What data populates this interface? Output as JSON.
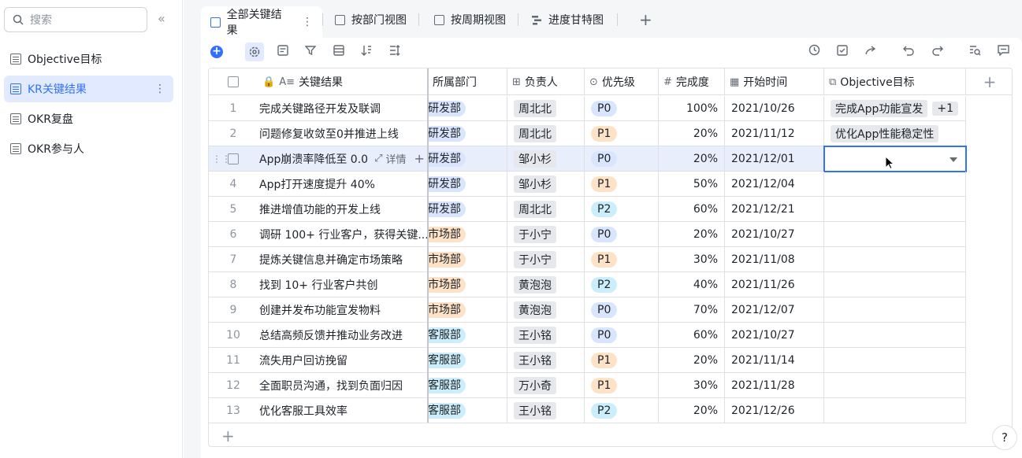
{
  "sidebar": {
    "search_placeholder": "搜索",
    "collapse_glyph": "«",
    "items": [
      {
        "label": "Objective目标"
      },
      {
        "label": "KR关键结果",
        "active": true
      },
      {
        "label": "OKR复盘"
      },
      {
        "label": "OKR参与人"
      }
    ],
    "more_glyph": "⋮"
  },
  "tabs": [
    {
      "label": "全部关键结果",
      "active": true
    },
    {
      "label": "按部门视图"
    },
    {
      "label": "按周期视图"
    },
    {
      "label": "进度甘特图"
    }
  ],
  "tab_more_glyph": "⋮",
  "tab_add_glyph": "+",
  "toolbar": {
    "add_glyph": "+",
    "left_icons": [
      "settings-icon",
      "form-icon",
      "filter-icon",
      "group-icon",
      "sort-icon",
      "row-height-icon"
    ],
    "right_icons": [
      "history-icon",
      "check-icon",
      "share-icon",
      "undo-icon",
      "redo-icon",
      "search-icon",
      "comment-icon"
    ]
  },
  "columns": {
    "kr": "关键结果",
    "dept": "所属部门",
    "owner": "负责人",
    "priority": "优先级",
    "progress": "完成度",
    "start": "开始时间",
    "objective": "Objective目标"
  },
  "row_hover": {
    "detail_label": "详情"
  },
  "rows": [
    {
      "no": "1",
      "kr": "完成关键路径开发及联调",
      "dept": "研发部",
      "owner": "周北北",
      "priority": "P0",
      "progress": "100%",
      "start": "2021/10/26",
      "objective": "完成App功能宣发",
      "objective_more": "+1"
    },
    {
      "no": "2",
      "kr": "问题修复收敛至0并推进上线",
      "dept": "研发部",
      "owner": "周北北",
      "priority": "P1",
      "progress": "20%",
      "start": "2021/11/12",
      "objective": "优化App性能稳定性",
      "objective_more": ""
    },
    {
      "no": "3",
      "kr": "App崩溃率降低至 0.0",
      "dept": "研发部",
      "owner": "邹小杉",
      "priority": "P0",
      "progress": "20%",
      "start": "2021/12/01",
      "objective": "",
      "objective_more": ""
    },
    {
      "no": "4",
      "kr": "App打开速度提升 40%",
      "dept": "研发部",
      "owner": "邹小杉",
      "priority": "P1",
      "progress": "50%",
      "start": "2021/12/04",
      "objective": "",
      "objective_more": ""
    },
    {
      "no": "5",
      "kr": "推进增值功能的开发上线",
      "dept": "研发部",
      "owner": "周北北",
      "priority": "P2",
      "progress": "60%",
      "start": "2021/12/21",
      "objective": "",
      "objective_more": ""
    },
    {
      "no": "6",
      "kr": "调研 100+ 行业客户，获得关键...",
      "dept": "市场部",
      "owner": "于小宁",
      "priority": "P0",
      "progress": "20%",
      "start": "2021/10/27",
      "objective": "",
      "objective_more": ""
    },
    {
      "no": "7",
      "kr": "提炼关键信息并确定市场策略",
      "dept": "市场部",
      "owner": "于小宁",
      "priority": "P1",
      "progress": "30%",
      "start": "2021/11/08",
      "objective": "",
      "objective_more": ""
    },
    {
      "no": "8",
      "kr": "找到 10+ 行业客户共创",
      "dept": "市场部",
      "owner": "黄泡泡",
      "priority": "P2",
      "progress": "40%",
      "start": "2021/11/26",
      "objective": "",
      "objective_more": ""
    },
    {
      "no": "9",
      "kr": "创建并发布功能宣发物料",
      "dept": "市场部",
      "owner": "黄泡泡",
      "priority": "P0",
      "progress": "70%",
      "start": "2021/12/07",
      "objective": "",
      "objective_more": ""
    },
    {
      "no": "10",
      "kr": "总结高频反馈并推动业务改进",
      "dept": "客服部",
      "owner": "王小铭",
      "priority": "P0",
      "progress": "60%",
      "start": "2021/10/27",
      "objective": "",
      "objective_more": ""
    },
    {
      "no": "11",
      "kr": "流失用户回访挽留",
      "dept": "客服部",
      "owner": "王小铭",
      "priority": "P1",
      "progress": "20%",
      "start": "2021/11/14",
      "objective": "",
      "objective_more": ""
    },
    {
      "no": "12",
      "kr": "全面职员沟通，找到负面归因",
      "dept": "客服部",
      "owner": "万小奇",
      "priority": "P1",
      "progress": "30%",
      "start": "2021/11/28",
      "objective": "",
      "objective_more": ""
    },
    {
      "no": "13",
      "kr": "优化客服工具效率",
      "dept": "客服部",
      "owner": "王小铭",
      "priority": "P2",
      "progress": "20%",
      "start": "2021/12/26",
      "objective": "",
      "objective_more": ""
    }
  ],
  "add_row_glyph": "+",
  "add_col_glyph": "+",
  "help_glyph": "?"
}
